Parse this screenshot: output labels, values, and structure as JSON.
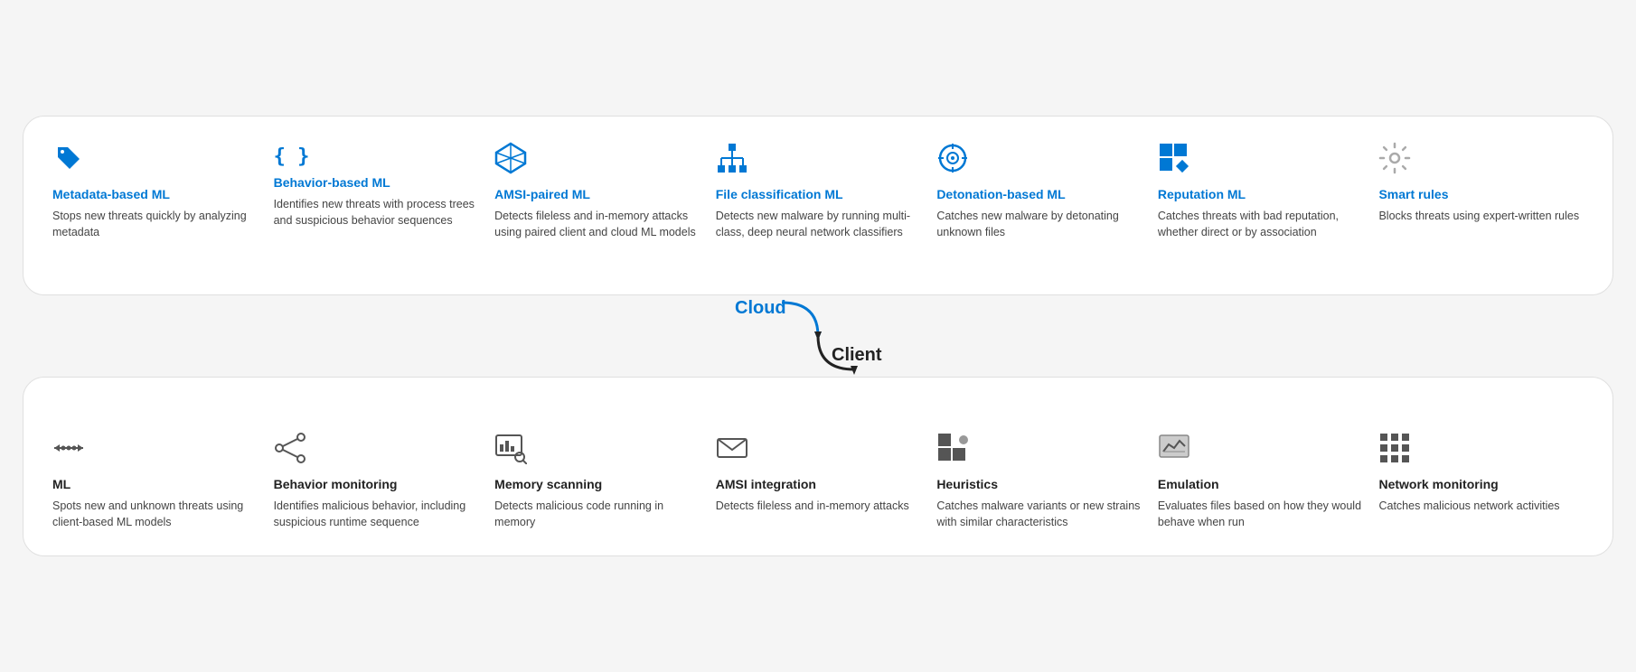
{
  "cloud": {
    "label": "Cloud",
    "items": [
      {
        "id": "metadata-ml",
        "icon": "tag",
        "title": "Metadata-based ML",
        "description": "Stops new threats quickly by analyzing metadata",
        "titleColor": "blue"
      },
      {
        "id": "behavior-ml",
        "icon": "code",
        "title": "Behavior-based ML",
        "description": "Identifies new threats with process trees and suspicious behavior sequences",
        "titleColor": "blue"
      },
      {
        "id": "amsi-ml",
        "icon": "amsi-cloud",
        "title": "AMSI-paired ML",
        "description": "Detects fileless and in-memory attacks using paired client and cloud ML models",
        "titleColor": "blue"
      },
      {
        "id": "file-class-ml",
        "icon": "hierarchy",
        "title": "File classification ML",
        "description": "Detects new malware by running multi-class, deep neural network classifiers",
        "titleColor": "blue"
      },
      {
        "id": "detonation-ml",
        "icon": "target",
        "title": "Detonation-based ML",
        "description": "Catches new malware by detonating unknown files",
        "titleColor": "blue"
      },
      {
        "id": "reputation-ml",
        "icon": "reputation",
        "title": "Reputation ML",
        "description": "Catches threats with bad reputation, whether direct or by association",
        "titleColor": "blue"
      },
      {
        "id": "smart-rules",
        "icon": "gear",
        "title": "Smart rules",
        "description": "Blocks threats using expert-written rules",
        "titleColor": "blue"
      }
    ]
  },
  "client": {
    "label": "Client",
    "items": [
      {
        "id": "client-ml",
        "icon": "arrows-lr",
        "title": "ML",
        "description": "Spots new and unknown threats using client-based ML models",
        "titleColor": "dark"
      },
      {
        "id": "behavior-mon",
        "icon": "share",
        "title": "Behavior monitoring",
        "description": "Identifies malicious behavior, including suspicious runtime sequence",
        "titleColor": "dark"
      },
      {
        "id": "memory-scan",
        "icon": "chart-search",
        "title": "Memory scanning",
        "description": "Detects malicious code running in memory",
        "titleColor": "dark"
      },
      {
        "id": "amsi-int",
        "icon": "envelope",
        "title": "AMSI integration",
        "description": "Detects fileless and in-memory attacks",
        "titleColor": "dark"
      },
      {
        "id": "heuristics",
        "icon": "heur",
        "title": "Heuristics",
        "description": "Catches malware variants or new strains with similar characteristics",
        "titleColor": "dark"
      },
      {
        "id": "emulation",
        "icon": "emul",
        "title": "Emulation",
        "description": "Evaluates files based on how they would behave when run",
        "titleColor": "dark"
      },
      {
        "id": "net-mon",
        "icon": "grid",
        "title": "Network monitoring",
        "description": "Catches malicious network activities",
        "titleColor": "dark"
      }
    ]
  }
}
